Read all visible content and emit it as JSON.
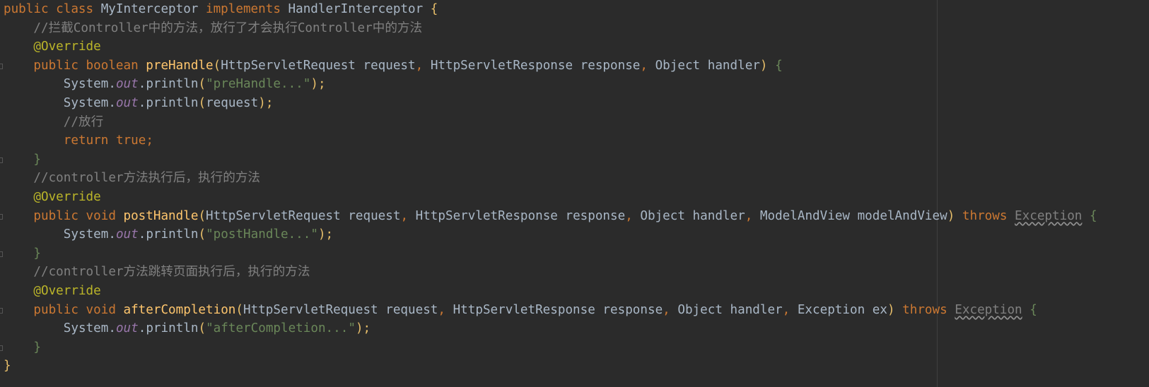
{
  "editor": {
    "lines": [
      {
        "indent": 0,
        "tokens": [
          {
            "t": "public class ",
            "c": "kw"
          },
          {
            "t": "MyInterceptor ",
            "c": "plain"
          },
          {
            "t": "implements ",
            "c": "kw"
          },
          {
            "t": "HandlerInterceptor ",
            "c": "plain"
          },
          {
            "t": "{",
            "c": "brace-y"
          }
        ]
      },
      {
        "indent": 1,
        "tokens": [
          {
            "t": "//拦截Controller中的方法，放行了才会执行Controller中的方法",
            "c": "cm"
          }
        ]
      },
      {
        "indent": 1,
        "tokens": [
          {
            "t": "@Override",
            "c": "ann"
          }
        ]
      },
      {
        "indent": 1,
        "tokens": [
          {
            "t": "public boolean ",
            "c": "kw"
          },
          {
            "t": "preHandle",
            "c": "fn"
          },
          {
            "t": "(",
            "c": "brace-y"
          },
          {
            "t": "HttpServletRequest request",
            "c": "plain"
          },
          {
            "t": ", ",
            "c": "kw"
          },
          {
            "t": "HttpServletResponse response",
            "c": "plain"
          },
          {
            "t": ", ",
            "c": "kw"
          },
          {
            "t": "Object handler",
            "c": "plain"
          },
          {
            "t": ") ",
            "c": "brace-y"
          },
          {
            "t": "{",
            "c": "brace-g"
          }
        ]
      },
      {
        "indent": 2,
        "tokens": [
          {
            "t": "System.",
            "c": "plain"
          },
          {
            "t": "out",
            "c": "fld"
          },
          {
            "t": ".println",
            "c": "plain"
          },
          {
            "t": "(",
            "c": "brace-y"
          },
          {
            "t": "\"preHandle...\"",
            "c": "str"
          },
          {
            "t": ");",
            "c": "brace-y"
          }
        ]
      },
      {
        "indent": 2,
        "tokens": [
          {
            "t": "System.",
            "c": "plain"
          },
          {
            "t": "out",
            "c": "fld"
          },
          {
            "t": ".println",
            "c": "plain"
          },
          {
            "t": "(",
            "c": "brace-y"
          },
          {
            "t": "request",
            "c": "plain"
          },
          {
            "t": ");",
            "c": "brace-y"
          }
        ]
      },
      {
        "indent": 2,
        "tokens": [
          {
            "t": "//放行",
            "c": "cm"
          }
        ]
      },
      {
        "indent": 2,
        "tokens": [
          {
            "t": "return true;",
            "c": "kw"
          }
        ]
      },
      {
        "indent": 1,
        "tokens": [
          {
            "t": "}",
            "c": "brace-g"
          }
        ]
      },
      {
        "indent": 1,
        "tokens": [
          {
            "t": "//controller方法执行后，执行的方法",
            "c": "cm"
          }
        ]
      },
      {
        "indent": 1,
        "tokens": [
          {
            "t": "@Override",
            "c": "ann"
          }
        ]
      },
      {
        "indent": 1,
        "tokens": [
          {
            "t": "public void ",
            "c": "kw"
          },
          {
            "t": "postHandle",
            "c": "fn"
          },
          {
            "t": "(",
            "c": "brace-y"
          },
          {
            "t": "HttpServletRequest request",
            "c": "plain"
          },
          {
            "t": ", ",
            "c": "kw"
          },
          {
            "t": "HttpServletResponse response",
            "c": "plain"
          },
          {
            "t": ", ",
            "c": "kw"
          },
          {
            "t": "Object handler",
            "c": "plain"
          },
          {
            "t": ", ",
            "c": "kw"
          },
          {
            "t": "ModelAndView modelAndView",
            "c": "plain"
          },
          {
            "t": ") ",
            "c": "brace-y"
          },
          {
            "t": "throws ",
            "c": "kw"
          },
          {
            "t": "Exception",
            "c": "warn"
          },
          {
            "t": " {",
            "c": "brace-g"
          }
        ]
      },
      {
        "indent": 2,
        "tokens": [
          {
            "t": "System.",
            "c": "plain"
          },
          {
            "t": "out",
            "c": "fld"
          },
          {
            "t": ".println",
            "c": "plain"
          },
          {
            "t": "(",
            "c": "brace-y"
          },
          {
            "t": "\"postHandle...\"",
            "c": "str"
          },
          {
            "t": ");",
            "c": "brace-y"
          }
        ]
      },
      {
        "indent": 1,
        "tokens": [
          {
            "t": "}",
            "c": "brace-g"
          }
        ]
      },
      {
        "indent": 1,
        "tokens": [
          {
            "t": "//controller方法跳转页面执行后，执行的方法",
            "c": "cm"
          }
        ]
      },
      {
        "indent": 1,
        "tokens": [
          {
            "t": "@Override",
            "c": "ann"
          }
        ]
      },
      {
        "indent": 1,
        "tokens": [
          {
            "t": "public void ",
            "c": "kw"
          },
          {
            "t": "afterCompletion",
            "c": "fn"
          },
          {
            "t": "(",
            "c": "brace-y"
          },
          {
            "t": "HttpServletRequest request",
            "c": "plain"
          },
          {
            "t": ", ",
            "c": "kw"
          },
          {
            "t": "HttpServletResponse response",
            "c": "plain"
          },
          {
            "t": ", ",
            "c": "kw"
          },
          {
            "t": "Object handler",
            "c": "plain"
          },
          {
            "t": ", ",
            "c": "kw"
          },
          {
            "t": "Exception ex",
            "c": "plain"
          },
          {
            "t": ") ",
            "c": "brace-y"
          },
          {
            "t": "throws ",
            "c": "kw"
          },
          {
            "t": "Exception",
            "c": "warn"
          },
          {
            "t": " {",
            "c": "brace-g"
          }
        ]
      },
      {
        "indent": 2,
        "tokens": [
          {
            "t": "System.",
            "c": "plain"
          },
          {
            "t": "out",
            "c": "fld"
          },
          {
            "t": ".println",
            "c": "plain"
          },
          {
            "t": "(",
            "c": "brace-y"
          },
          {
            "t": "\"afterCompletion...\"",
            "c": "str"
          },
          {
            "t": ");",
            "c": "brace-y"
          }
        ]
      },
      {
        "indent": 1,
        "tokens": [
          {
            "t": "}",
            "c": "brace-g"
          }
        ]
      },
      {
        "indent": 0,
        "tokens": [
          {
            "t": "}",
            "c": "brace-y"
          }
        ]
      }
    ],
    "fold_marker_lines": [
      3,
      8,
      11,
      13,
      16,
      18
    ],
    "colors": {
      "background": "#2b2b2b",
      "keyword": "#cc7832",
      "method": "#ffc66d",
      "string": "#6a8759",
      "annotation": "#bbb529",
      "comment": "#808080",
      "field": "#9876aa",
      "text": "#a9b7c6"
    }
  }
}
